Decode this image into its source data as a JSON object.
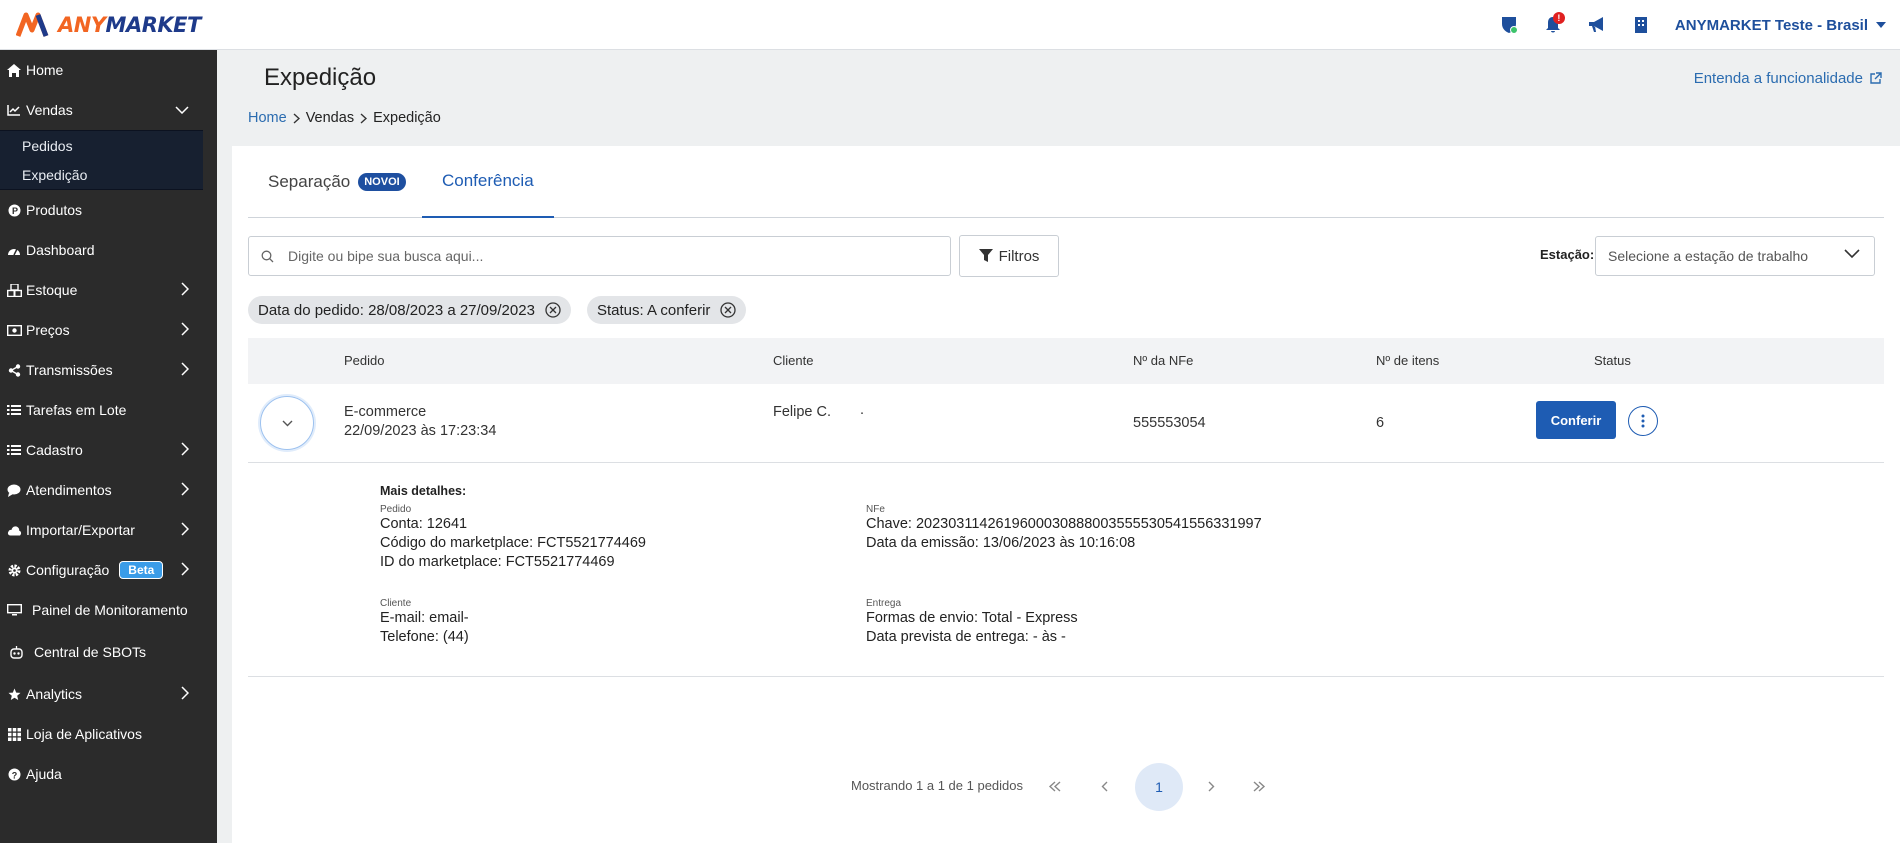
{
  "header": {
    "logo_text_a": "ANY",
    "logo_text_b": "MARKET",
    "notification_count": "!",
    "account_name": "ANYMARKET Teste - Brasil",
    "icons": [
      "shield-status-icon",
      "bell-icon",
      "megaphone-icon",
      "building-icon"
    ]
  },
  "sidebar": {
    "items": [
      {
        "label": "Home",
        "icon": "home-icon"
      },
      {
        "label": "Vendas",
        "icon": "chart-line-icon"
      },
      {
        "label": "Pedidos"
      },
      {
        "label": "Expedição"
      },
      {
        "label": "Produtos",
        "icon": "product-icon"
      },
      {
        "label": "Dashboard",
        "icon": "dashboard-icon"
      },
      {
        "label": "Estoque",
        "icon": "boxes-icon"
      },
      {
        "label": "Preços",
        "icon": "money-icon"
      },
      {
        "label": "Transmissões",
        "icon": "share-icon"
      },
      {
        "label": "Tarefas em Lote",
        "icon": "list-icon"
      },
      {
        "label": "Cadastro",
        "icon": "list-icon"
      },
      {
        "label": "Atendimentos",
        "icon": "chat-icon"
      },
      {
        "label": "Importar/Exportar",
        "icon": "cloud-icon"
      },
      {
        "label": "Configuração",
        "icon": "gear-icon",
        "badge": "Beta"
      },
      {
        "label": "Painel de Monitoramento",
        "icon": "monitor-icon"
      },
      {
        "label": "Central de SBOTs",
        "icon": "robot-icon"
      },
      {
        "label": "Analytics",
        "icon": "star-icon"
      },
      {
        "label": "Loja de Aplicativos",
        "icon": "grid-icon"
      },
      {
        "label": "Ajuda",
        "icon": "question-icon"
      }
    ]
  },
  "page": {
    "title": "Expedição",
    "help_link": "Entenda a funcionalidade",
    "breadcrumb": [
      "Home",
      "Vendas",
      "Expedição"
    ]
  },
  "tabs": [
    {
      "label": "Separação",
      "badge": "NOVOI"
    },
    {
      "label": "Conferência"
    }
  ],
  "toolbar": {
    "search_placeholder": "Digite ou bipe sua busca aqui...",
    "filters_label": "Filtros",
    "station_label": "Estação:",
    "station_placeholder": "Selecione a estação de trabalho"
  },
  "chips": [
    {
      "label": "Data do pedido: 28/08/2023 a 27/09/2023"
    },
    {
      "label": "Status: A conferir"
    }
  ],
  "table": {
    "columns": [
      "Pedido",
      "Cliente",
      "Nº da NFe",
      "Nº de itens",
      "Status"
    ],
    "rows": [
      {
        "pedido_channel": "E-commerce",
        "pedido_date": "22/09/2023 às 17:23:34",
        "cliente": "Felipe C.",
        "cliente_extra": ".",
        "nfe": "555553054",
        "itens": "6",
        "action": "Conferir"
      }
    ]
  },
  "details": {
    "title": "Mais detalhes:",
    "pedido_label": "Pedido",
    "pedido_lines": [
      "Conta: 12641",
      "Código do marketplace: FCT5521774469",
      "ID do marketplace: FCT5521774469"
    ],
    "nfe_label": "NFe",
    "nfe_lines": [
      "Chave: 20230311426196000308880035555305415563319​97",
      "Data da emissão: 13/06/2023 às 10:16:08"
    ],
    "cliente_label": "Cliente",
    "cliente_lines": [
      "E-mail: email-",
      "Telefone: (44)"
    ],
    "entrega_label": "Entrega",
    "entrega_lines": [
      "Formas de envio: Total - Express",
      "Data prevista de entrega: - às -"
    ]
  },
  "pagination": {
    "info": "Mostrando 1 a 1 de 1 pedidos",
    "current_page": "1"
  },
  "colors": {
    "primary": "#1e5cb3",
    "sidebar_bg": "#2b2b2b",
    "logo_orange": "#f26522"
  }
}
